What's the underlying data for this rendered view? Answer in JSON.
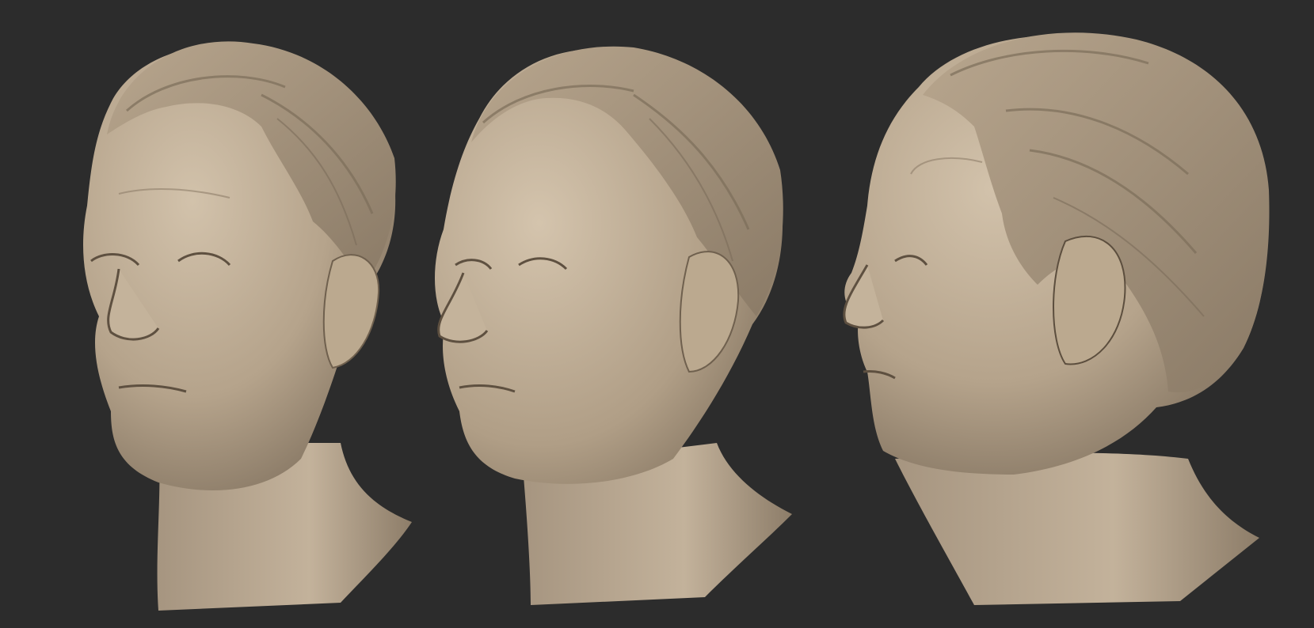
{
  "scene": {
    "background_color": "#2c2c2c",
    "sculpt_color": "#b7a690",
    "views": [
      {
        "name": "three-quarter-left-view"
      },
      {
        "name": "three-quarter-left-view-rotated"
      },
      {
        "name": "profile-left-view"
      }
    ]
  }
}
